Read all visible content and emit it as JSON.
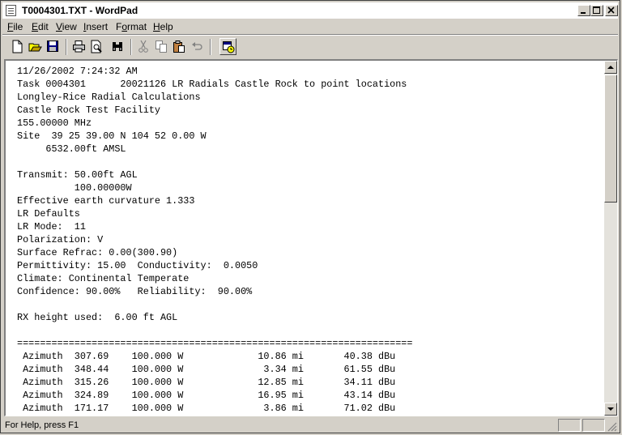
{
  "window": {
    "title": "T0004301.TXT - WordPad",
    "minimize": "_",
    "maximize": "□",
    "close": "✕"
  },
  "menu": [
    {
      "ul": "F",
      "rest": "ile"
    },
    {
      "ul": "E",
      "rest": "dit"
    },
    {
      "ul": "V",
      "rest": "iew"
    },
    {
      "ul": "I",
      "rest": "nsert"
    },
    {
      "pre": "F",
      "ul": "o",
      "rest": "rmat"
    },
    {
      "ul": "H",
      "rest": "elp"
    }
  ],
  "toolbar": {
    "icons": [
      "new-document-icon",
      "open-folder-icon",
      "save-disk-icon",
      "print-icon",
      "print-preview-icon",
      "find-binoculars-icon",
      "cut-scissors-icon",
      "copy-icon",
      "paste-icon",
      "undo-icon",
      "insert-datetime-icon"
    ]
  },
  "document": {
    "lines": [
      "11/26/2002 7:24:32 AM",
      "Task 0004301      20021126 LR Radials Castle Rock to point locations",
      "Longley-Rice Radial Calculations",
      "Castle Rock Test Facility",
      "155.00000 MHz",
      "Site  39 25 39.00 N 104 52 0.00 W",
      "     6532.00ft AMSL",
      "",
      "Transmit: 50.00ft AGL",
      "          100.00000W",
      "Effective earth curvature 1.333",
      "LR Defaults",
      "LR Mode:  11",
      "Polarization: V",
      "Surface Refrac: 0.00(300.90)",
      "Permittivity: 15.00  Conductivity:  0.0050",
      "Climate: Continental Temperate",
      "Confidence: 90.00%   Reliability:  90.00%",
      "",
      "RX height used:  6.00 ft AGL",
      "",
      "=====================================================================",
      " Azimuth  307.69    100.000 W             10.86 mi       40.38 dBu",
      " Azimuth  348.44    100.000 W              3.34 mi       61.55 dBu",
      " Azimuth  315.26    100.000 W             12.85 mi       34.11 dBu",
      " Azimuth  324.89    100.000 W             16.95 mi       43.14 dBu",
      " Azimuth  171.17    100.000 W              3.86 mi       71.02 dBu"
    ]
  },
  "status": {
    "text": "For Help, press F1"
  }
}
